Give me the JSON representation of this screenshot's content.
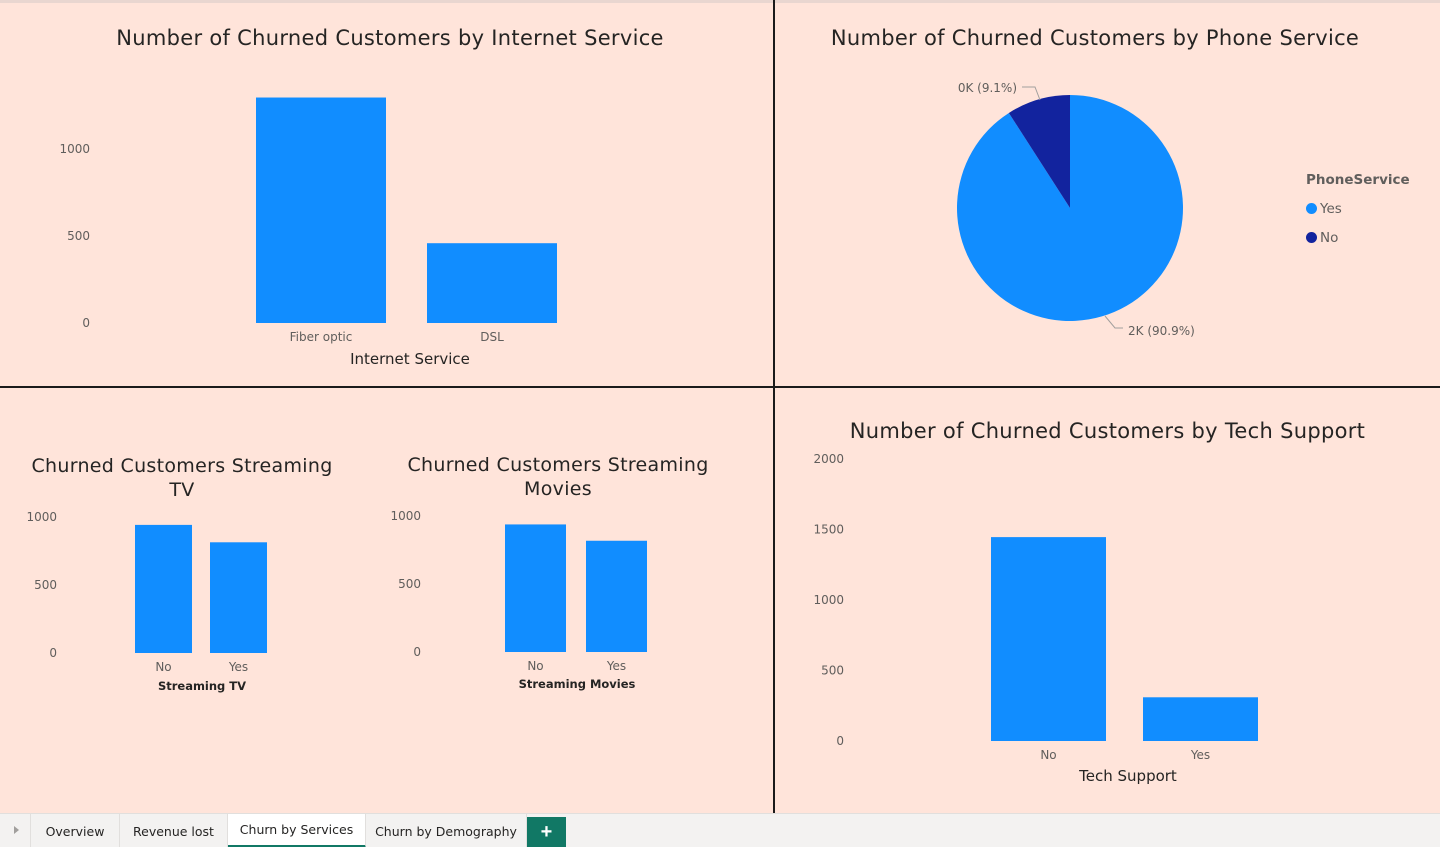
{
  "charts": {
    "internet": {
      "title": "Number of Churned Customers by Internet Service",
      "xlabel": "Internet Service"
    },
    "phone": {
      "title": "Number of Churned Customers by Phone Service",
      "legend_title": "PhoneService"
    },
    "tv": {
      "title": "Churned Customers Streaming TV",
      "xlabel": "Streaming TV"
    },
    "movies": {
      "title": "Churned Customers Streaming Movies",
      "xlabel": "Streaming Movies"
    },
    "tech": {
      "title": "Number of Churned Customers by Tech Support",
      "xlabel": "Tech Support"
    }
  },
  "chart_data": [
    {
      "type": "bar",
      "title": "Number of Churned Customers by Internet Service",
      "xlabel": "Internet Service",
      "ylabel": "",
      "categories": [
        "Fiber optic",
        "DSL"
      ],
      "values": [
        1297,
        459
      ],
      "ylim": [
        0,
        1300
      ],
      "yticks": [
        0,
        500,
        1000
      ],
      "color": "#118dff"
    },
    {
      "type": "pie",
      "title": "Number of Churned Customers by Phone Service",
      "legend_title": "PhoneService",
      "legend_position": "right",
      "categories": [
        "Yes",
        "No"
      ],
      "values": [
        1699,
        170
      ],
      "labels": [
        "2K (90.9%)",
        "0K (9.1%)"
      ],
      "colors": [
        "#118dff",
        "#12239e"
      ]
    },
    {
      "type": "bar",
      "title": "Churned Customers Streaming TV",
      "xlabel": "Streaming TV",
      "categories": [
        "No",
        "Yes"
      ],
      "values": [
        942,
        814
      ],
      "ylim": [
        0,
        1000
      ],
      "yticks": [
        0,
        500,
        1000
      ],
      "color": "#118dff"
    },
    {
      "type": "bar",
      "title": "Churned Customers Streaming Movies",
      "xlabel": "Streaming Movies",
      "categories": [
        "No",
        "Yes"
      ],
      "values": [
        938,
        818
      ],
      "ylim": [
        0,
        1000
      ],
      "yticks": [
        0,
        500,
        1000
      ],
      "color": "#118dff"
    },
    {
      "type": "bar",
      "title": "Number of Churned Customers by Tech Support",
      "xlabel": "Tech Support",
      "categories": [
        "No",
        "Yes"
      ],
      "values": [
        1446,
        310
      ],
      "ylim": [
        0,
        2000
      ],
      "yticks": [
        0,
        500,
        1000,
        1500,
        2000
      ],
      "color": "#118dff"
    }
  ],
  "tabs": [
    {
      "label": "Overview",
      "active": false
    },
    {
      "label": "Revenue lost",
      "active": false
    },
    {
      "label": "Churn by Services",
      "active": true
    },
    {
      "label": "Churn by Demography",
      "active": false
    }
  ],
  "add_tab_label": "+"
}
